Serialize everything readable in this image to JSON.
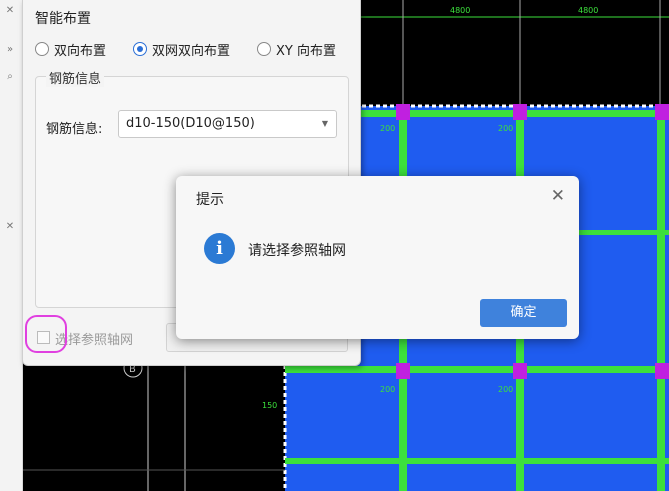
{
  "cad": {
    "dimension_top_left": "4800",
    "dimension_top_right": "4800",
    "axis_label": "B",
    "column_labels": [
      "150",
      "200",
      "200"
    ],
    "slab_labels": [
      "150",
      "150"
    ],
    "colors": {
      "slab": "#1f5cf0",
      "beam": "#3ce03c",
      "column": "#c020e0"
    }
  },
  "panel": {
    "title": "智能布置",
    "radios": [
      {
        "label": "双向布置",
        "checked": false
      },
      {
        "label": "双网双向布置",
        "checked": true
      },
      {
        "label": "XY 向布置",
        "checked": false
      }
    ],
    "group_title": "钢筋信息",
    "rebar_label": "钢筋信息:",
    "rebar_value": "d10-150(D10@150)",
    "checkbox_label": "选择参照轴网"
  },
  "dialog": {
    "title": "提示",
    "message": "请选择参照轴网",
    "ok_label": "确定",
    "info_icon": "info-icon",
    "close_icon": "close-icon"
  }
}
